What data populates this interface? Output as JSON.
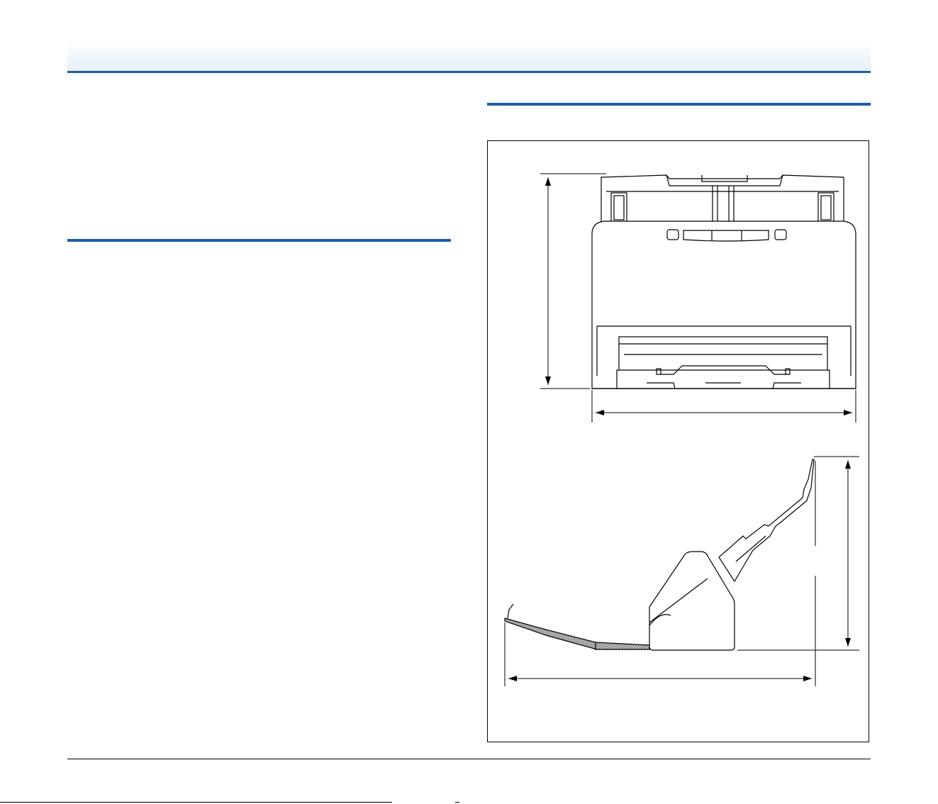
{
  "colors": {
    "accent": "#1c5fa8",
    "line": "#000000",
    "header_gradient_end": "#e6eef7"
  },
  "figure": {
    "views": [
      "front-view",
      "side-view"
    ],
    "front_view": {
      "dimensions": [
        "height",
        "width"
      ]
    },
    "side_view": {
      "dimensions": [
        "height",
        "depth"
      ]
    }
  }
}
